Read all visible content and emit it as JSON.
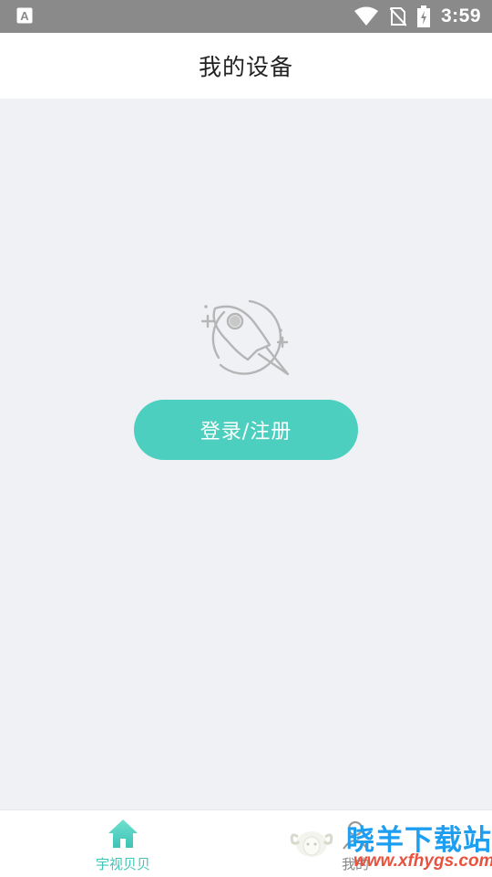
{
  "status_bar": {
    "time": "3:59",
    "left_icon": "a-notification-icon",
    "icons": [
      "wifi-icon",
      "no-sim-icon",
      "battery-charging-icon"
    ]
  },
  "header": {
    "title": "我的设备"
  },
  "main": {
    "illustration_icon": "rocket-icon",
    "login_button_label": "登录/注册"
  },
  "tabbar": {
    "items": [
      {
        "label": "宇视贝贝",
        "icon": "home-icon",
        "active": true
      },
      {
        "label": "我的",
        "icon": "profile-icon",
        "active": false
      }
    ]
  },
  "watermark": {
    "name": "晓羊下载站",
    "url": "www.xfhygs.com"
  },
  "colors": {
    "accent": "#4dcfbf",
    "status_bar": "#8a8a8a",
    "background": "#f0f1f5",
    "watermark_blue": "#1e9ef0",
    "watermark_red": "#e8523e"
  }
}
